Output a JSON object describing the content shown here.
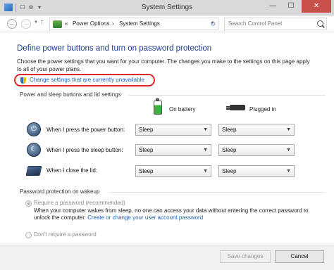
{
  "window": {
    "title": "System Settings",
    "minimize": "—",
    "maximize": "☐",
    "close": "✕",
    "quick_access": [
      "☐",
      "⚙",
      "▾"
    ]
  },
  "nav": {
    "back": "←",
    "forward": "→",
    "up": "↑",
    "address_prefix": "«",
    "breadcrumb": [
      "Power Options",
      "System Settings"
    ],
    "separator": "›",
    "refresh": "↻",
    "search_placeholder": "Search Control Panel"
  },
  "main": {
    "title": "Define power buttons and turn on password protection",
    "description": "Choose the power settings that you want for your computer. The changes you make to the settings on this page apply to all of your power plans.",
    "change_link": "Change settings that are currently unavailable",
    "buttons_section": "Power and sleep buttons and lid settings",
    "col_battery": "On battery",
    "col_plugged": "Plugged in",
    "rows": [
      {
        "label": "When I press the power button:",
        "battery": "Sleep",
        "plugged": "Sleep"
      },
      {
        "label": "When I press the sleep button:",
        "battery": "Sleep",
        "plugged": "Sleep"
      },
      {
        "label": "When I close the lid:",
        "battery": "Sleep",
        "plugged": "Sleep"
      }
    ],
    "password_section": "Password protection on wakeup",
    "require_label": "Require a password (recommended)",
    "require_desc": "When your computer wakes from sleep, no one can access your data without entering the correct password to unlock the computer.",
    "account_link": "Create or change your user account password",
    "dont_require_label": "Don't require a password"
  },
  "footer": {
    "save": "Save changes",
    "cancel": "Cancel"
  },
  "colors": {
    "title_blue": "#1e3c8c",
    "link_blue": "#1a5fb4",
    "highlight_red": "#e0262b",
    "close_red": "#c7504a"
  }
}
